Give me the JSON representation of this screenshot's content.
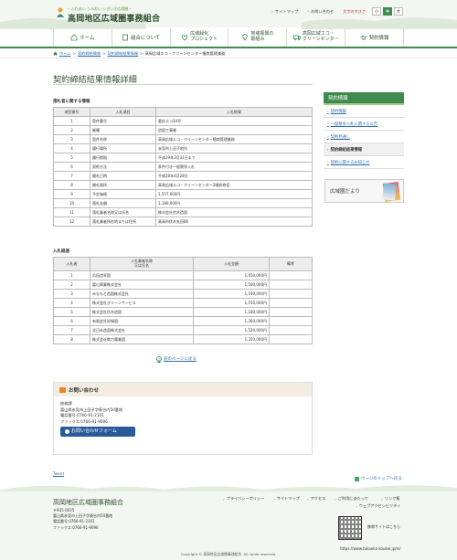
{
  "header": {
    "catchphrase": "─ ふれあい うるおい いきいき広域圏 ─",
    "site_title": "高岡地区広域圏事務組合",
    "util_links": [
      "サイトマップ",
      "お問い合わせ"
    ],
    "font_size_label": "文字の大きさ",
    "font_sizes": [
      "小",
      "中",
      "大"
    ]
  },
  "gnav": [
    {
      "label": "ホーム",
      "icon": "home-icon"
    },
    {
      "label": "組合について",
      "icon": "document-icon"
    },
    {
      "label": "広域緑化\nプロジェクト",
      "icon": "heart-leaf-icon"
    },
    {
      "label": "地域振興の\n取組み",
      "icon": "location-pin-icon"
    },
    {
      "label": "高岡広域エコ・\nクリーンセンター",
      "icon": "truck-icon"
    },
    {
      "label": "契約情報",
      "icon": "handshake-icon"
    }
  ],
  "breadcrumb": [
    "ホーム",
    "契約締結情報",
    "契約締結結果情報",
    "高岡広域エコ・クリーンセンター植栽管理業務"
  ],
  "page": {
    "title": "契約締結結果情報詳細",
    "section1": "落札者に関する情報",
    "section2": "入札経過",
    "back_label": "前のページに戻る"
  },
  "info_table": {
    "headers": [
      "項目番号",
      "入札項目",
      "入札結果"
    ],
    "rows": [
      [
        "1",
        "案件番号",
        "委託エコ34号"
      ],
      [
        "2",
        "業種",
        "造園工事業"
      ],
      [
        "3",
        "案件名称",
        "高岡広域エコ・クリーンセンター植栽管理業務"
      ],
      [
        "4",
        "履行場所",
        "氷見市上田子地内"
      ],
      [
        "5",
        "履行期限",
        "平成29年3月31日まで"
      ],
      [
        "6",
        "契約方法",
        "条件付き一般競争入札"
      ],
      [
        "7",
        "開札日時",
        "平成28年4月28日"
      ],
      [
        "8",
        "開札場所",
        "高岡広域エコ・クリーンセンター2階研修室"
      ],
      [
        "9",
        "予定価格",
        "1,557,000円"
      ],
      [
        "10",
        "落札金額",
        "1,180,000円"
      ],
      [
        "11",
        "落札業者名称又は氏名",
        "株式会社伏木造園"
      ],
      [
        "12",
        "落札業者所在地または住所",
        "高岡市伏木矢田86"
      ]
    ]
  },
  "bid_table": {
    "headers": [
      "入札者",
      "入札業者名称\n又は氏名",
      "入札金額",
      "備考"
    ],
    "rows": [
      [
        "1",
        "浜田造率園",
        "1,450,000円",
        ""
      ],
      [
        "2",
        "富山興業株式会社",
        "1,500,000円",
        ""
      ],
      [
        "3",
        "みなもと造園株式会社",
        "1,190,000円",
        ""
      ],
      [
        "4",
        "株式会社グリーンサービス",
        "1,550,000円",
        ""
      ],
      [
        "5",
        "株式会社伏木造園",
        "1,180,000円",
        ""
      ],
      [
        "6",
        "有限会社好緑園",
        "1,360,000円",
        ""
      ],
      [
        "7",
        "北日本造園株式会社",
        "1,520,000円",
        ""
      ],
      [
        "8",
        "株式会社帯刀電業園",
        "1,350,000円",
        ""
      ]
    ]
  },
  "contact": {
    "heading": "お問い合わせ",
    "lines": [
      "総務課",
      "富山県氷見市上田子字筱谷内50番地",
      "電話番号:0766-91-2101",
      "ファックス:0766-91-9096"
    ],
    "button": "お問い合わせフォーム"
  },
  "sidebar": {
    "heading": "契約情報",
    "items": [
      "契約情報",
      "一般競争入札に関する公告",
      "契約見通し",
      "契約締結結果情報",
      "契約に関するお知らせ"
    ],
    "banner": "広域圏だより"
  },
  "tweet": "Tweet",
  "pagetop": "ページのトップへ戻る",
  "footer": {
    "name": "高岡地区広域圏事務組合",
    "addr": [
      "〒935-0035",
      "富山県氷見市上田子字筱谷内50番地",
      "電話番号:0766-91-2101",
      "ファックス:0766-91-9096"
    ],
    "links": [
      "プライバシーポリシー",
      "サイトマップ",
      "アクセス",
      "ご利用にあたって",
      "リンク集",
      "ウェブアクセシビリティ"
    ],
    "qr_note": "携帯サイトはこちら",
    "url": "https://www.takaoka-koukei.jp/m/",
    "copyright": "Copyright © 高岡地区広域圏事務組合. All rights reserved."
  }
}
